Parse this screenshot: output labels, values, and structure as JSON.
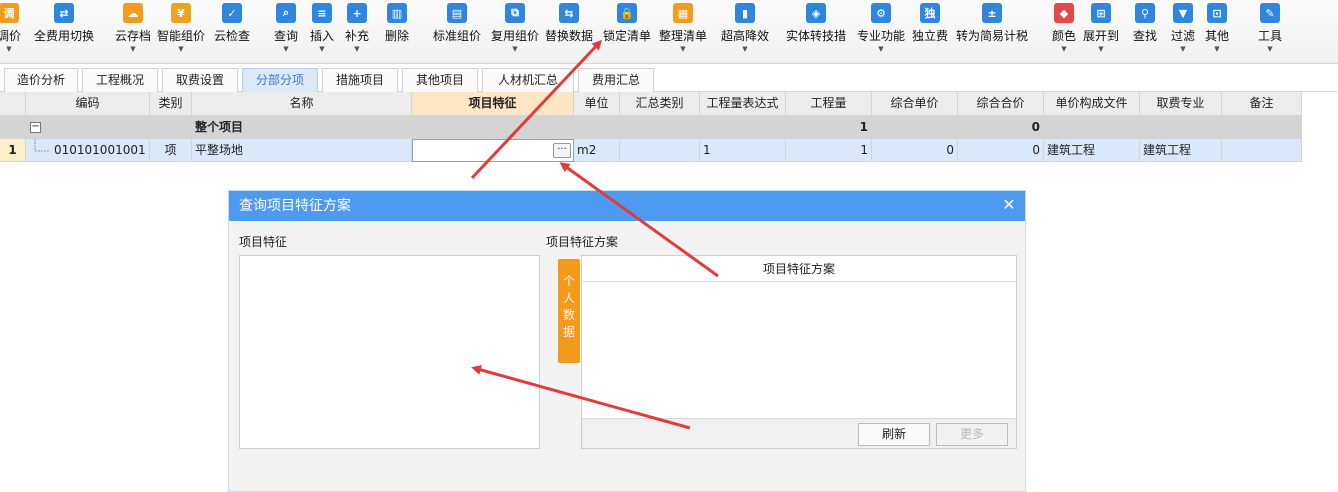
{
  "toolbar": {
    "items": [
      {
        "label": "调价",
        "icon": "adjust-price-icon",
        "glyph": "调",
        "color": "#f29b1d"
      },
      {
        "label": "全费用切换",
        "icon": "full-cost-switch-icon",
        "glyph": "⇄",
        "color": "#2e86de"
      },
      {
        "label": "云存档",
        "icon": "cloud-archive-icon",
        "glyph": "☁",
        "color": "#f29b1d"
      },
      {
        "label": "智能组价",
        "icon": "smart-pricing-icon",
        "glyph": "¥",
        "color": "#f0a11e"
      },
      {
        "label": "云检查",
        "icon": "cloud-check-icon",
        "glyph": "✓",
        "color": "#2e86de"
      },
      {
        "label": "查询",
        "icon": "query-icon",
        "glyph": "⌕",
        "color": "#2e86de"
      },
      {
        "label": "插入",
        "icon": "insert-icon",
        "glyph": "≡",
        "color": "#2e86de"
      },
      {
        "label": "补充",
        "icon": "supplement-icon",
        "glyph": "+",
        "color": "#2e86de"
      },
      {
        "label": "删除",
        "icon": "delete-icon",
        "glyph": "▥",
        "color": "#2e86de"
      },
      {
        "label": "标准组价",
        "icon": "standard-pricing-icon",
        "glyph": "▤",
        "color": "#2e86de"
      },
      {
        "label": "复用组价",
        "icon": "reuse-pricing-icon",
        "glyph": "⧉",
        "color": "#2e86de"
      },
      {
        "label": "替换数据",
        "icon": "replace-data-icon",
        "glyph": "⇆",
        "color": "#2e86de"
      },
      {
        "label": "锁定清单",
        "icon": "lock-list-icon",
        "glyph": "🔒",
        "color": "#2e86de"
      },
      {
        "label": "整理清单",
        "icon": "organize-list-icon",
        "glyph": "▦",
        "color": "#f29b1d"
      },
      {
        "label": "超高降效",
        "icon": "super-high-icon",
        "glyph": "▮",
        "color": "#2e86de"
      },
      {
        "label": "实体转技措",
        "icon": "entity-convert-icon",
        "glyph": "◈",
        "color": "#2e86de"
      },
      {
        "label": "专业功能",
        "icon": "professional-function-icon",
        "glyph": "⚙",
        "color": "#2e86de"
      },
      {
        "label": "独立费",
        "icon": "independent-fee-icon",
        "glyph": "独",
        "color": "#2e86de"
      },
      {
        "label": "转为简易计税",
        "icon": "simple-tax-icon",
        "glyph": "±",
        "color": "#2e86de"
      },
      {
        "label": "颜色",
        "icon": "color-icon",
        "glyph": "◆",
        "color": "#e04a4a"
      },
      {
        "label": "展开到",
        "icon": "expand-to-icon",
        "glyph": "⊞",
        "color": "#2e86de"
      },
      {
        "label": "查找",
        "icon": "find-icon",
        "glyph": "⚲",
        "color": "#2e86de"
      },
      {
        "label": "过滤",
        "icon": "filter-icon",
        "glyph": "▼",
        "color": "#2e86de"
      },
      {
        "label": "其他",
        "icon": "other-icon",
        "glyph": "⊡",
        "color": "#2e86de"
      },
      {
        "label": "工具",
        "icon": "tools-icon",
        "glyph": "✎",
        "color": "#2e86de"
      }
    ]
  },
  "tabs": [
    {
      "label": "造价分析"
    },
    {
      "label": "工程概况"
    },
    {
      "label": "取费设置"
    },
    {
      "label": "分部分项",
      "active": true
    },
    {
      "label": "措施项目"
    },
    {
      "label": "其他项目"
    },
    {
      "label": "人材机汇总"
    },
    {
      "label": "费用汇总"
    }
  ],
  "grid": {
    "headers": [
      "编码",
      "类别",
      "名称",
      "项目特征",
      "单位",
      "汇总类别",
      "工程量表达式",
      "工程量",
      "综合单价",
      "综合合价",
      "单价构成文件",
      "取费专业",
      "备注"
    ],
    "row0": {
      "name": "整个项目",
      "quantity": "1",
      "total": "0"
    },
    "row1": {
      "num": "1",
      "code": "010101001001",
      "category": "项",
      "name": "平整场地",
      "feature": "",
      "unit": "m2",
      "summary": "",
      "expr": "1",
      "quantity": "1",
      "unit_price": "0",
      "total_price": "0",
      "price_file": "建筑工程",
      "fee_major": "建筑工程",
      "note": ""
    }
  },
  "dialog": {
    "title": "查询项目特征方案",
    "feature_label": "项目特征",
    "scheme_label": "项目特征方案",
    "personal_tab": "个人数据",
    "scheme_header": "项目特征方案",
    "refresh_btn": "刷新",
    "more_btn": "更多"
  },
  "colors": {
    "accent": "#4d9af0",
    "tab_active": "#3d7bd1",
    "feature_header": "#fde6c4",
    "personal_tab": "#f39a1c",
    "arrow": "#e03c3c"
  }
}
